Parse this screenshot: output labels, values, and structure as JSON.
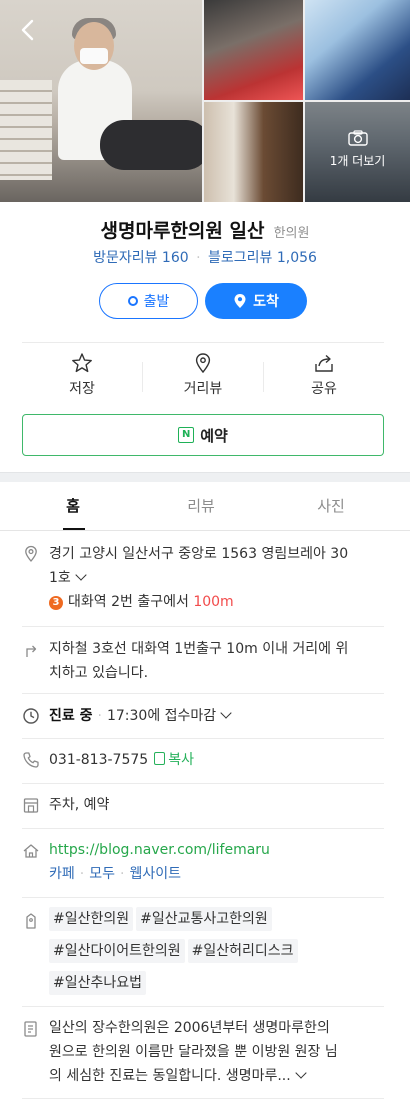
{
  "gallery": {
    "more_label": "1개 더보기"
  },
  "header": {
    "name": "생명마루한의원 일산",
    "category": "한의원",
    "visitor_review": "방문자리뷰 160",
    "blog_review": "블로그리뷰 1,056"
  },
  "buttons": {
    "depart": "출발",
    "arrive": "도착"
  },
  "actions": {
    "save": "저장",
    "distance_view": "거리뷰",
    "share": "공유"
  },
  "reserve": {
    "badge": "N",
    "label": "예약"
  },
  "tabs": [
    {
      "label": "홈"
    },
    {
      "label": "리뷰"
    },
    {
      "label": "사진"
    }
  ],
  "info": {
    "address_line1": "경기 고양시 일산서구 중앙로 1563 영림브레아 30",
    "address_line2": "1호",
    "subway_line": "3",
    "subway_text": "대화역 2번 출구에서 ",
    "subway_distance": "100m",
    "directions_line1": "지하철 3호선 대화역 1번출구 10m 이내 거리에 위",
    "directions_line2": "치하고 있습니다.",
    "hours_status": "진료 중",
    "hours_detail": "17:30에 접수마감",
    "phone": "031-813-7575",
    "copy_label": "복사",
    "amenities": "주차, 예약",
    "homepage": "https://blog.naver.com/lifemaru",
    "links": [
      "카페",
      "모두",
      "웹사이트"
    ],
    "tags": [
      "#일산한의원",
      "#일산교통사고한의원",
      "#일산다이어트한의원",
      "#일산허리디스크",
      "#일산추나요법"
    ],
    "desc_line1": "일산의 장수한의원은 2006년부터 생명마루한의",
    "desc_line2": "원으로 한의원 이름만 달라졌을 뿐 이방원 원장 님",
    "desc_line3": "의 세심한 진료는 동일합니다. 생명마루..."
  },
  "colors": {
    "primary_blue": "#1a80ff",
    "naver_green": "#26b15b",
    "distance_red": "#f24b4b",
    "line3_orange": "#ef6a21"
  }
}
